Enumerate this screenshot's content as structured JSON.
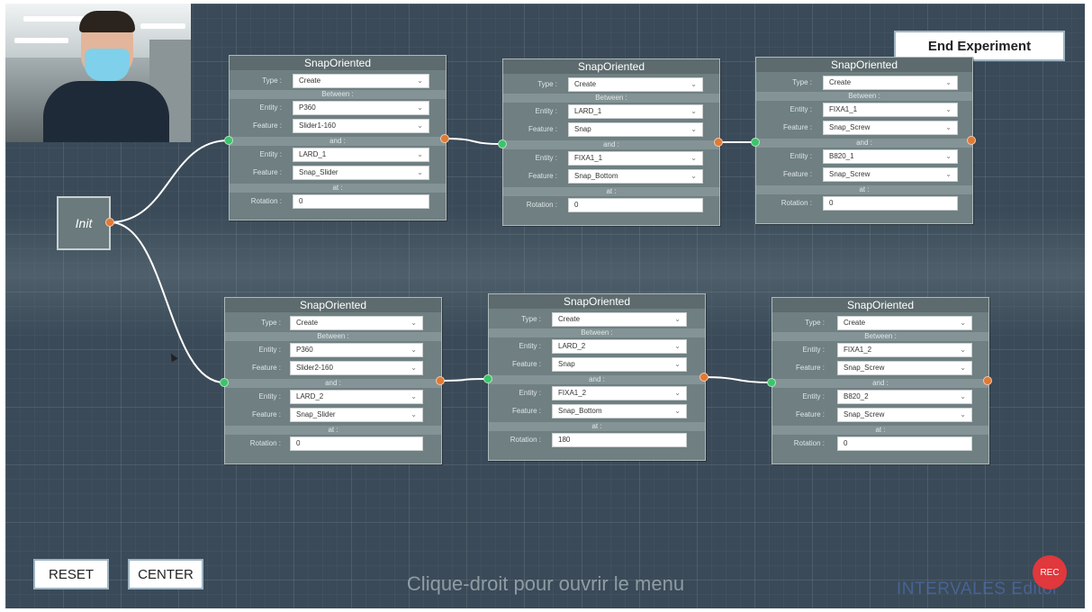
{
  "webcam": {},
  "end_experiment": "End Experiment",
  "init_node": "Init",
  "node_title": "SnapOriented",
  "labels": {
    "type": "Type :",
    "between": "Between :",
    "entity": "Entity :",
    "feature": "Feature :",
    "and": "and :",
    "at": "at :",
    "rotation": "Rotation :"
  },
  "nodes": [
    {
      "type": "Create",
      "entity1": "P360",
      "feature1": "Slider1-160",
      "entity2": "LARD_1",
      "feature2": "Snap_Slider",
      "rotation": "0"
    },
    {
      "type": "Create",
      "entity1": "LARD_1",
      "feature1": "Snap",
      "entity2": "FIXA1_1",
      "feature2": "Snap_Bottom",
      "rotation": "0"
    },
    {
      "type": "Create",
      "entity1": "FIXA1_1",
      "feature1": "Snap_Screw",
      "entity2": "B820_1",
      "feature2": "Snap_Screw",
      "rotation": "0"
    },
    {
      "type": "Create",
      "entity1": "P360",
      "feature1": "Slider2-160",
      "entity2": "LARD_2",
      "feature2": "Snap_Slider",
      "rotation": "0"
    },
    {
      "type": "Create",
      "entity1": "LARD_2",
      "feature1": "Snap",
      "entity2": "FIXA1_2",
      "feature2": "Snap_Bottom",
      "rotation": "180"
    },
    {
      "type": "Create",
      "entity1": "FIXA1_2",
      "feature1": "Snap_Screw",
      "entity2": "B820_2",
      "feature2": "Snap_Screw",
      "rotation": "0"
    }
  ],
  "reset": "RESET",
  "center": "CENTER",
  "hint": "Clique-droit pour ouvrir le menu",
  "rec": "REC",
  "brand": "INTERVALES Editor",
  "colors": {
    "canvas": "#3a4a58",
    "node": "#6f7f82",
    "port_in": "#3cc46a",
    "port_out": "#e07a35",
    "rec": "#e0383c"
  }
}
